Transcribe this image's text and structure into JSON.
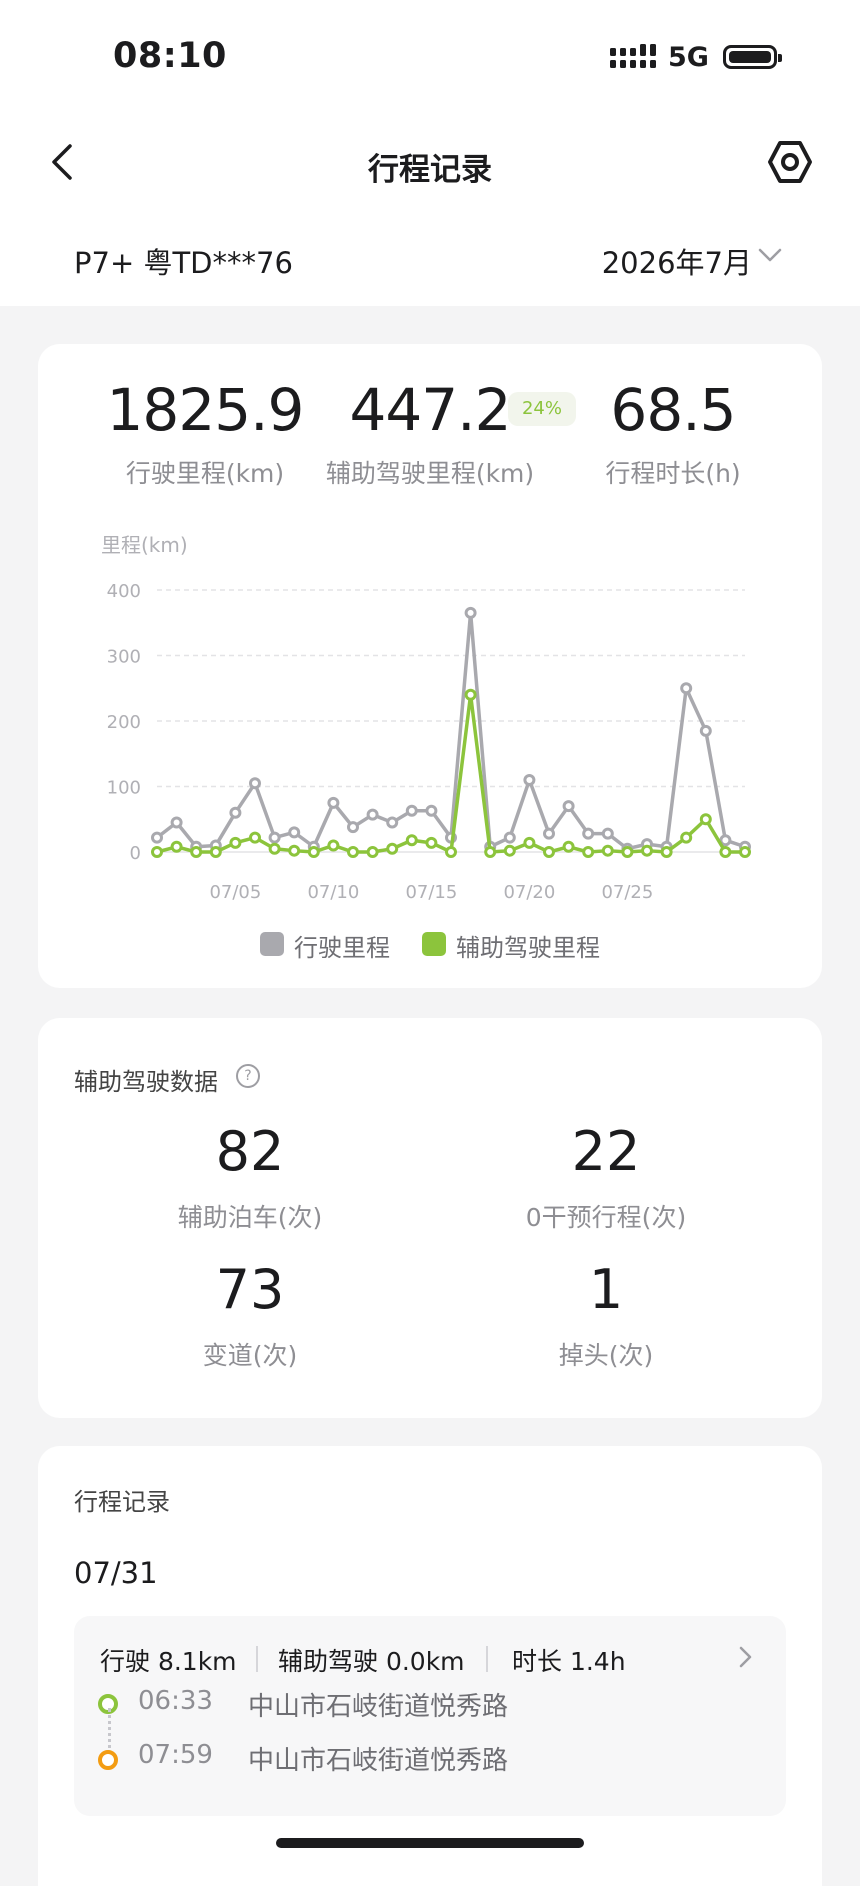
{
  "status": {
    "time": "08:10",
    "network": "5G"
  },
  "nav": {
    "title": "行程记录"
  },
  "vehicle": "P7+ 粤TD***76",
  "month": "2026年7月",
  "stats": {
    "total_mileage": "1825.9",
    "total_mileage_label": "行驶里程(km)",
    "assist_mileage": "447.2",
    "assist_pct": "24%",
    "assist_mileage_label": "辅助驾驶里程(km)",
    "duration": "68.5",
    "duration_label": "行程时长(h)"
  },
  "chart_data": {
    "type": "line",
    "ylabel": "里程(km)",
    "ylim": [
      0,
      400
    ],
    "yticks": [
      0,
      100,
      200,
      300,
      400
    ],
    "x": [
      "07/01",
      "07/02",
      "07/03",
      "07/04",
      "07/05",
      "07/06",
      "07/07",
      "07/08",
      "07/09",
      "07/10",
      "07/11",
      "07/12",
      "07/13",
      "07/14",
      "07/15",
      "07/16",
      "07/17",
      "07/18",
      "07/19",
      "07/20",
      "07/21",
      "07/22",
      "07/23",
      "07/24",
      "07/25",
      "07/26",
      "07/27",
      "07/28",
      "07/29",
      "07/30",
      "07/31"
    ],
    "xtick_labels": [
      "07/05",
      "07/10",
      "07/15",
      "07/20",
      "07/25"
    ],
    "series": [
      {
        "name": "行驶里程",
        "color": "#a9a9ae",
        "values": [
          22,
          45,
          8,
          10,
          60,
          105,
          22,
          30,
          8,
          75,
          38,
          57,
          45,
          63,
          63,
          22,
          365,
          8,
          22,
          110,
          28,
          70,
          28,
          28,
          5,
          12,
          8,
          250,
          185,
          18,
          8
        ]
      },
      {
        "name": "辅助驾驶里程",
        "color": "#8cc43c",
        "values": [
          0,
          8,
          0,
          0,
          14,
          22,
          5,
          2,
          0,
          10,
          0,
          0,
          5,
          18,
          14,
          0,
          240,
          0,
          2,
          14,
          0,
          8,
          0,
          2,
          0,
          2,
          0,
          22,
          50,
          0,
          0
        ]
      }
    ],
    "grid": true,
    "legend": "bottom"
  },
  "assist": {
    "title": "辅助驾驶数据",
    "items": [
      {
        "value": "82",
        "label": "辅助泊车(次)"
      },
      {
        "value": "22",
        "label": "0干预行程(次)"
      },
      {
        "value": "73",
        "label": "变道(次)"
      },
      {
        "value": "1",
        "label": "掉头(次)"
      }
    ]
  },
  "trips": {
    "title": "行程记录",
    "date": "07/31",
    "item": {
      "drive": "行驶 8.1km",
      "assist": "辅助驾驶 0.0km",
      "duration": "时长 1.4h",
      "start_time": "06:33",
      "start_place": "中山市石岐街道悦秀路",
      "end_time": "07:59",
      "end_place": "中山市石岐街道悦秀路"
    }
  }
}
